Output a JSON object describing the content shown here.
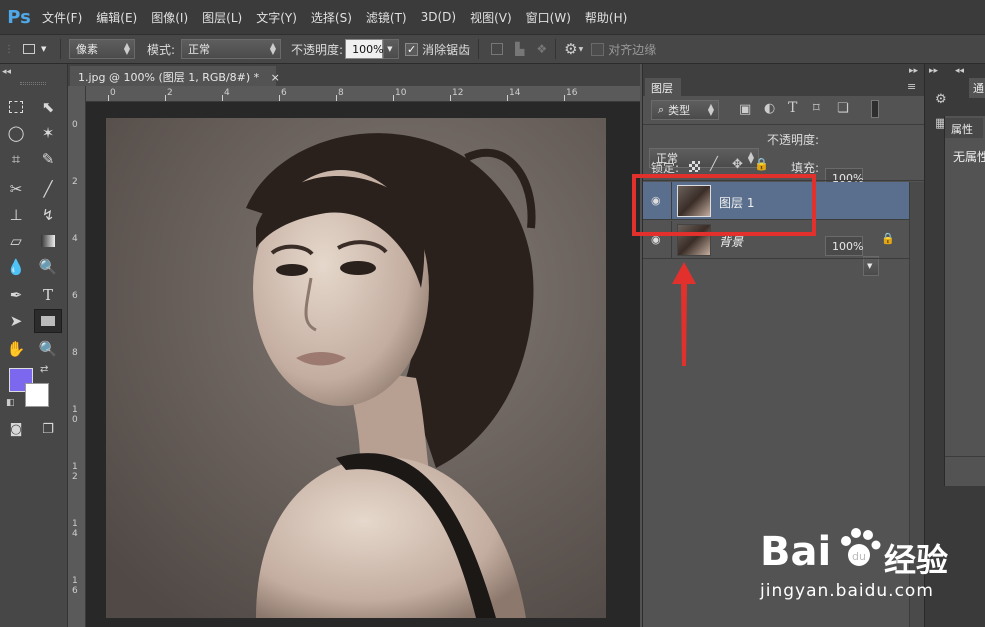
{
  "app": {
    "logo": "Ps"
  },
  "menu": [
    "文件(F)",
    "编辑(E)",
    "图像(I)",
    "图层(L)",
    "文字(Y)",
    "选择(S)",
    "滤镜(T)",
    "3D(D)",
    "视图(V)",
    "窗口(W)",
    "帮助(H)"
  ],
  "options": {
    "unit_select": "像素",
    "mode_label": "模式:",
    "mode_value": "正常",
    "opacity_label": "不透明度:",
    "opacity_value": "100%",
    "antialias_label": "消除锯齿",
    "align_edges_label": "对齐边缘"
  },
  "document": {
    "tab_title": "1.jpg @ 100% (图层 1, RGB/8#) *",
    "close_symbol": "×"
  },
  "rulers": {
    "h": [
      "0",
      "2",
      "4",
      "6",
      "8",
      "10",
      "12",
      "14",
      "16"
    ],
    "v": [
      "0",
      "2",
      "4",
      "6",
      "8",
      "1\n0",
      "1\n2",
      "1\n4",
      "1\n6"
    ]
  },
  "layers_panel": {
    "tab_label": "图层",
    "filter_kind": "类型",
    "blend_mode": "正常",
    "opacity_label": "不透明度:",
    "opacity_value": "100%",
    "lock_label": "锁定:",
    "fill_label": "填充:",
    "fill_value": "100%",
    "layers": [
      {
        "name": "图层 1",
        "selected": true
      },
      {
        "name": "背景",
        "locked": true
      }
    ]
  },
  "properties_panel": {
    "tab_label": "属性",
    "content": "无属性"
  },
  "right_col": {
    "top_tab": "通"
  },
  "watermark": {
    "brand": "Bai",
    "brand2": "经验",
    "url": "jingyan.baidu.com"
  },
  "colors": {
    "foreground": "#7b68ee",
    "background": "#ffffff",
    "highlight": "#e2312c",
    "selected_layer": "#5a6f8e"
  }
}
